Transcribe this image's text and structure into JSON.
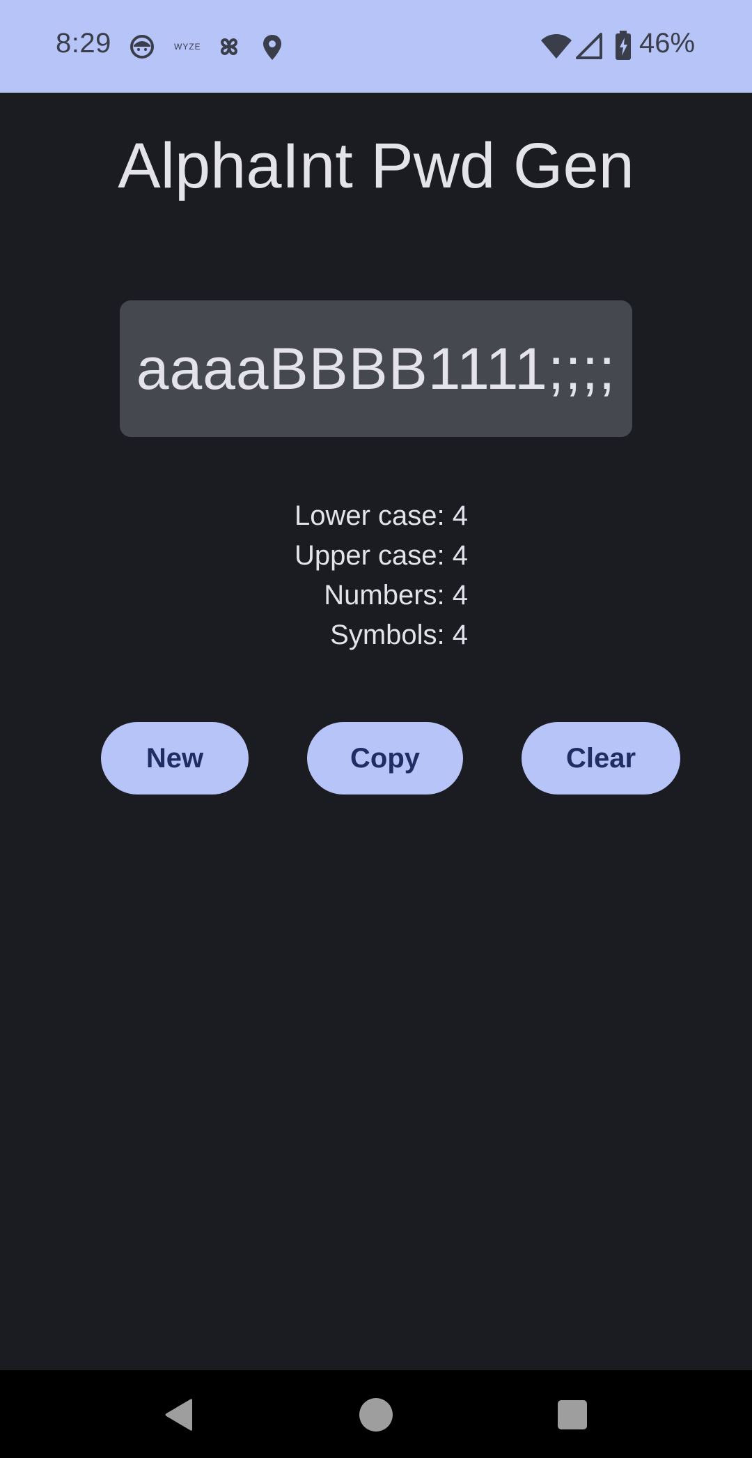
{
  "status_bar": {
    "time": "8:29",
    "notification_icons": [
      "face-icon",
      "wyze-icon",
      "pinwheel-icon",
      "location-pin-icon"
    ],
    "wyze_text": "WYZE",
    "battery_percent": "46%",
    "system_icons": [
      "wifi-icon",
      "cell-signal-icon",
      "battery-charging-icon"
    ]
  },
  "app": {
    "title": "AlphaInt Pwd Gen",
    "password": "aaaaBBBB1111;;;;",
    "stats": {
      "lower": "Lower case: 4",
      "upper": "Upper case: 4",
      "numbers": "Numbers: 4",
      "symbols": "Symbols: 4"
    },
    "buttons": {
      "new": "New",
      "copy": "Copy",
      "clear": "Clear"
    }
  },
  "nav_bar": {
    "icons": [
      "back-icon",
      "home-icon",
      "recents-icon"
    ]
  },
  "colors": {
    "status_bar_bg": "#b6c4f8",
    "background": "#1b1c21",
    "password_box_bg": "#45484f",
    "button_bg": "#b6c4f8",
    "button_text": "#1e2d63",
    "text": "#e4e3ea"
  }
}
